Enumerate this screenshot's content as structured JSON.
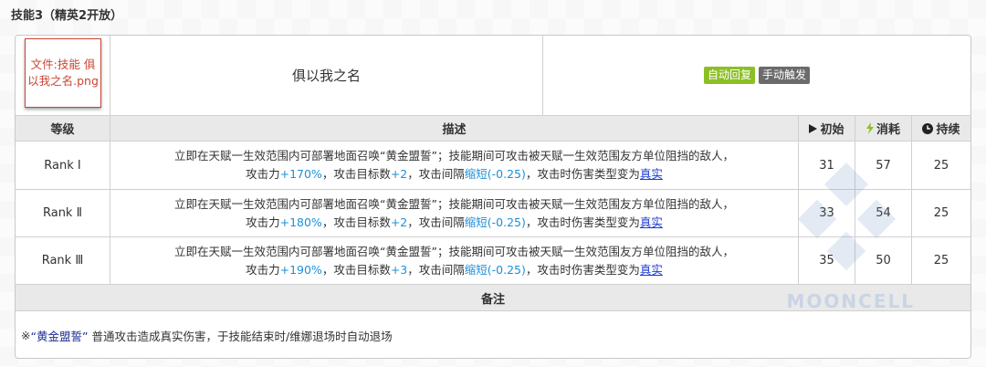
{
  "heading": "技能3（精英2开放）",
  "skill": {
    "image_alt": "文件:技能 俱以我之名.png",
    "name": "俱以我之名",
    "tag_recovery": "自动回复",
    "tag_trigger": "手动触发",
    "colors": {
      "recovery": "#8cbf26",
      "trigger": "#6b6b6b"
    }
  },
  "table_header": {
    "level": "等级",
    "description": "描述",
    "initial": "初始",
    "cost": "消耗",
    "duration": "持续",
    "icons": {
      "initial": "play-triangle-icon",
      "cost": "lightning-icon",
      "duration": "clock-icon"
    }
  },
  "desc_common": {
    "line1": "立即在天赋一生效范围内可部署地面召唤“黄金盟誓”；技能期间可攻击被天赋一生效范围友方单位阻挡的敌人，",
    "atk_prefix": "攻击力",
    "targets_prefix": "，攻击目标数",
    "interval_prefix": "，攻击间隔",
    "interval_value": "缩短(-0.25)",
    "damage_prefix": "，攻击时伤害类型变为",
    "damage_type": "真实"
  },
  "ranks": [
    {
      "level": "Rank Ⅰ",
      "atk": "+170%",
      "targets": "+2",
      "initial": "31",
      "cost": "57",
      "duration": "25"
    },
    {
      "level": "Rank Ⅱ",
      "atk": "+180%",
      "targets": "+2",
      "initial": "33",
      "cost": "54",
      "duration": "25"
    },
    {
      "level": "Rank Ⅲ",
      "atk": "+190%",
      "targets": "+3",
      "initial": "35",
      "cost": "50",
      "duration": "25"
    }
  ],
  "notes": {
    "title": "备注",
    "mark": "※",
    "summon_name": "“黄金盟誓”",
    "text": "普通攻击造成真实伤害，于技能结束时/维娜退场时自动退场"
  },
  "watermark": "MOONCELL"
}
